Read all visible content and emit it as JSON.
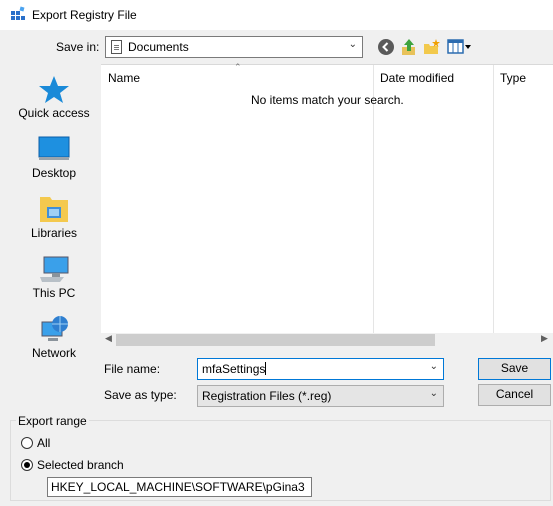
{
  "window": {
    "title": "Export Registry File"
  },
  "toolbar": {
    "save_in_label": "Save in:",
    "save_in_value": "Documents",
    "icons": [
      "back-icon",
      "up-folder-icon",
      "new-folder-icon",
      "view-menu-icon"
    ]
  },
  "places": [
    {
      "label": "Quick access",
      "icon": "star-icon"
    },
    {
      "label": "Desktop",
      "icon": "desktop-icon"
    },
    {
      "label": "Libraries",
      "icon": "libraries-icon"
    },
    {
      "label": "This PC",
      "icon": "computer-icon"
    },
    {
      "label": "Network",
      "icon": "network-icon"
    }
  ],
  "file_list": {
    "columns": [
      "Name",
      "Date modified",
      "Type"
    ],
    "empty_message": "No items match your search."
  },
  "form": {
    "file_name_label": "File name:",
    "file_name_value": "mfaSettings",
    "save_as_type_label": "Save as type:",
    "save_as_type_value": "Registration Files (*.reg)",
    "save_label": "Save",
    "cancel_label": "Cancel"
  },
  "export_range": {
    "title": "Export range",
    "all_label": "All",
    "selected_branch_label": "Selected branch",
    "selected_option": "selected_branch",
    "branch_value": "HKEY_LOCAL_MACHINE\\SOFTWARE\\pGina3"
  },
  "colors": {
    "accent": "#0078d7",
    "dialog_bg": "#f0f0f0"
  }
}
